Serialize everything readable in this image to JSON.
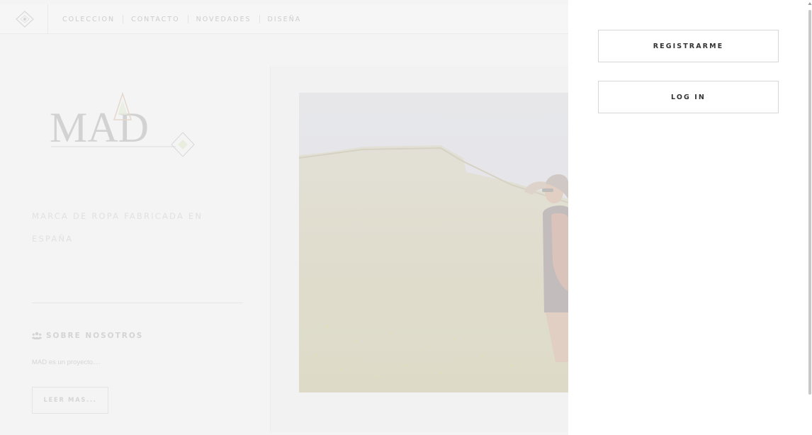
{
  "nav": {
    "items": [
      "COLECCION",
      "CONTACTO",
      "NOVEDADES",
      "DISEÑA"
    ]
  },
  "brand": {
    "logo_text": "MAD",
    "tagline": "MARCA DE ROPA FABRICADA EN ESPAÑA"
  },
  "about": {
    "icon": "users-icon",
    "title": "SOBRE NOSOTROS",
    "text": "MAD es un proyecto....",
    "button_label": "LEER MAS..."
  },
  "account": {
    "register_label": "REGISTRARME",
    "login_label": "LOG IN"
  },
  "colors": {
    "panel_bg": "#ffffff",
    "button_border": "#d7d7d7",
    "button_text": "#333333",
    "overlay_tint": "#f4f4f4"
  }
}
